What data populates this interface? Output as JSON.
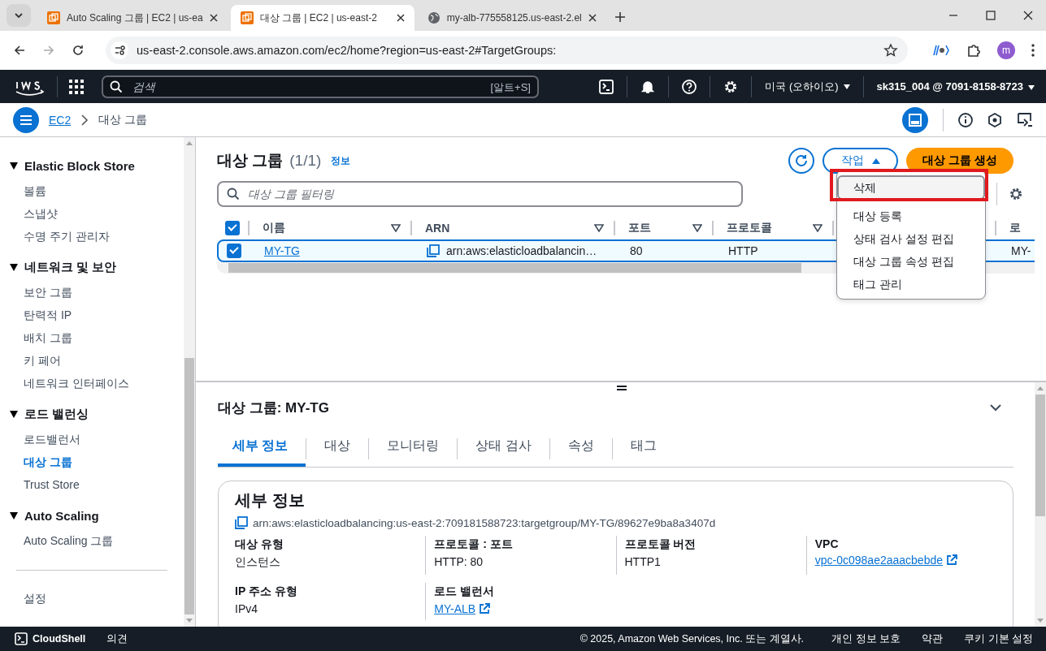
{
  "browser": {
    "tabs": [
      {
        "title": "Auto Scaling 그룹 | EC2 | us-ea",
        "selected": false,
        "kind": "aws"
      },
      {
        "title": "대상 그룹 | EC2 | us-east-2",
        "selected": true,
        "kind": "aws"
      },
      {
        "title": "my-alb-775558125.us-east-2.el",
        "selected": false,
        "kind": "globe"
      }
    ],
    "url": "us-east-2.console.aws.amazon.com/ec2/home?region=us-east-2#TargetGroups:",
    "profile_initial": "m"
  },
  "top_nav": {
    "search_placeholder": "검색",
    "search_shortcut": "[알트+S]",
    "region": "미국 (오하이오)",
    "account": "sk315_004 @ 7091-8158-8723"
  },
  "breadcrumb": [
    "EC2",
    "대상 그룹"
  ],
  "sidebar": {
    "sections": [
      {
        "title": "Elastic Block Store",
        "expanded": true,
        "items": [
          {
            "label": "볼륨",
            "selected": false
          },
          {
            "label": "스냅샷",
            "selected": false
          },
          {
            "label": "수명 주기 관리자",
            "selected": false
          }
        ]
      },
      {
        "title": "네트워크 및 보안",
        "expanded": true,
        "items": [
          {
            "label": "보안 그룹",
            "selected": false
          },
          {
            "label": "탄력적 IP",
            "selected": false
          },
          {
            "label": "배치 그룹",
            "selected": false
          },
          {
            "label": "키 페어",
            "selected": false
          },
          {
            "label": "네트워크 인터페이스",
            "selected": false
          }
        ]
      },
      {
        "title": "로드 밸런싱",
        "expanded": true,
        "items": [
          {
            "label": "로드밸런서",
            "selected": false
          },
          {
            "label": "대상 그룹",
            "selected": true
          },
          {
            "label": "Trust Store",
            "selected": false
          }
        ]
      },
      {
        "title": "Auto Scaling",
        "expanded": true,
        "items": [
          {
            "label": "Auto Scaling 그룹",
            "selected": false
          }
        ]
      }
    ],
    "settings": "설정"
  },
  "target_groups": {
    "title": "대상 그룹",
    "count": "(1/1)",
    "info": "정보",
    "actions_button": "작업",
    "create_button": "대상 그룹 생성",
    "filter_placeholder": "대상 그룹 필터링",
    "all_selected": true,
    "columns": [
      "이름",
      "ARN",
      "포트",
      "프로토콜",
      "",
      "로"
    ],
    "rows": [
      {
        "selected": true,
        "cells": [
          "MY-TG",
          "arn:aws:elasticloadbalancin…",
          "80",
          "HTTP",
          "",
          "MY-"
        ]
      }
    ]
  },
  "actions_menu": {
    "expanded": true,
    "items": [
      {
        "label": "삭제",
        "highlighted": true,
        "marked": true
      },
      {
        "label": "대상 등록",
        "highlighted": false,
        "marked": false
      },
      {
        "label": "상태 검사 설정 편집",
        "highlighted": false,
        "marked": false
      },
      {
        "label": "대상 그룹 속성 편집",
        "highlighted": false,
        "marked": false
      },
      {
        "label": "태그 관리",
        "highlighted": false,
        "marked": false
      }
    ]
  },
  "details": {
    "title": "대상 그룹: MY-TG",
    "tabs": [
      {
        "label": "세부 정보",
        "selected": true
      },
      {
        "label": "대상",
        "selected": false
      },
      {
        "label": "모니터링",
        "selected": false
      },
      {
        "label": "상태 검사",
        "selected": false
      },
      {
        "label": "속성",
        "selected": false
      },
      {
        "label": "태그",
        "selected": false
      }
    ],
    "card_title": "세부 정보",
    "arn": "arn:aws:elasticloadbalancing:us-east-2:709181588723:targetgroup/MY-TG/89627e9ba8a3407d",
    "fields": [
      {
        "label": "대상 유형",
        "value": "인스턴스",
        "kind": "text"
      },
      {
        "label": "프로토콜 : 포트",
        "value": "HTTP: 80",
        "kind": "text"
      },
      {
        "label": "프로토콜 버전",
        "value": "HTTP1",
        "kind": "text"
      },
      {
        "label": "VPC",
        "value": "vpc-0c098ae2aaacbebde",
        "kind": "link"
      },
      {
        "label": "IP 주소 유형",
        "value": "IPv4",
        "kind": "text"
      },
      {
        "label": "로드 밸런서",
        "value": "MY-ALB",
        "kind": "link"
      }
    ]
  },
  "footer": {
    "cloudshell": "CloudShell",
    "feedback": "의견",
    "copyright": "© 2025, Amazon Web Services, Inc. 또는 계열사.",
    "links": [
      "개인 정보 보호",
      "약관",
      "쿠키 기본 설정"
    ]
  }
}
